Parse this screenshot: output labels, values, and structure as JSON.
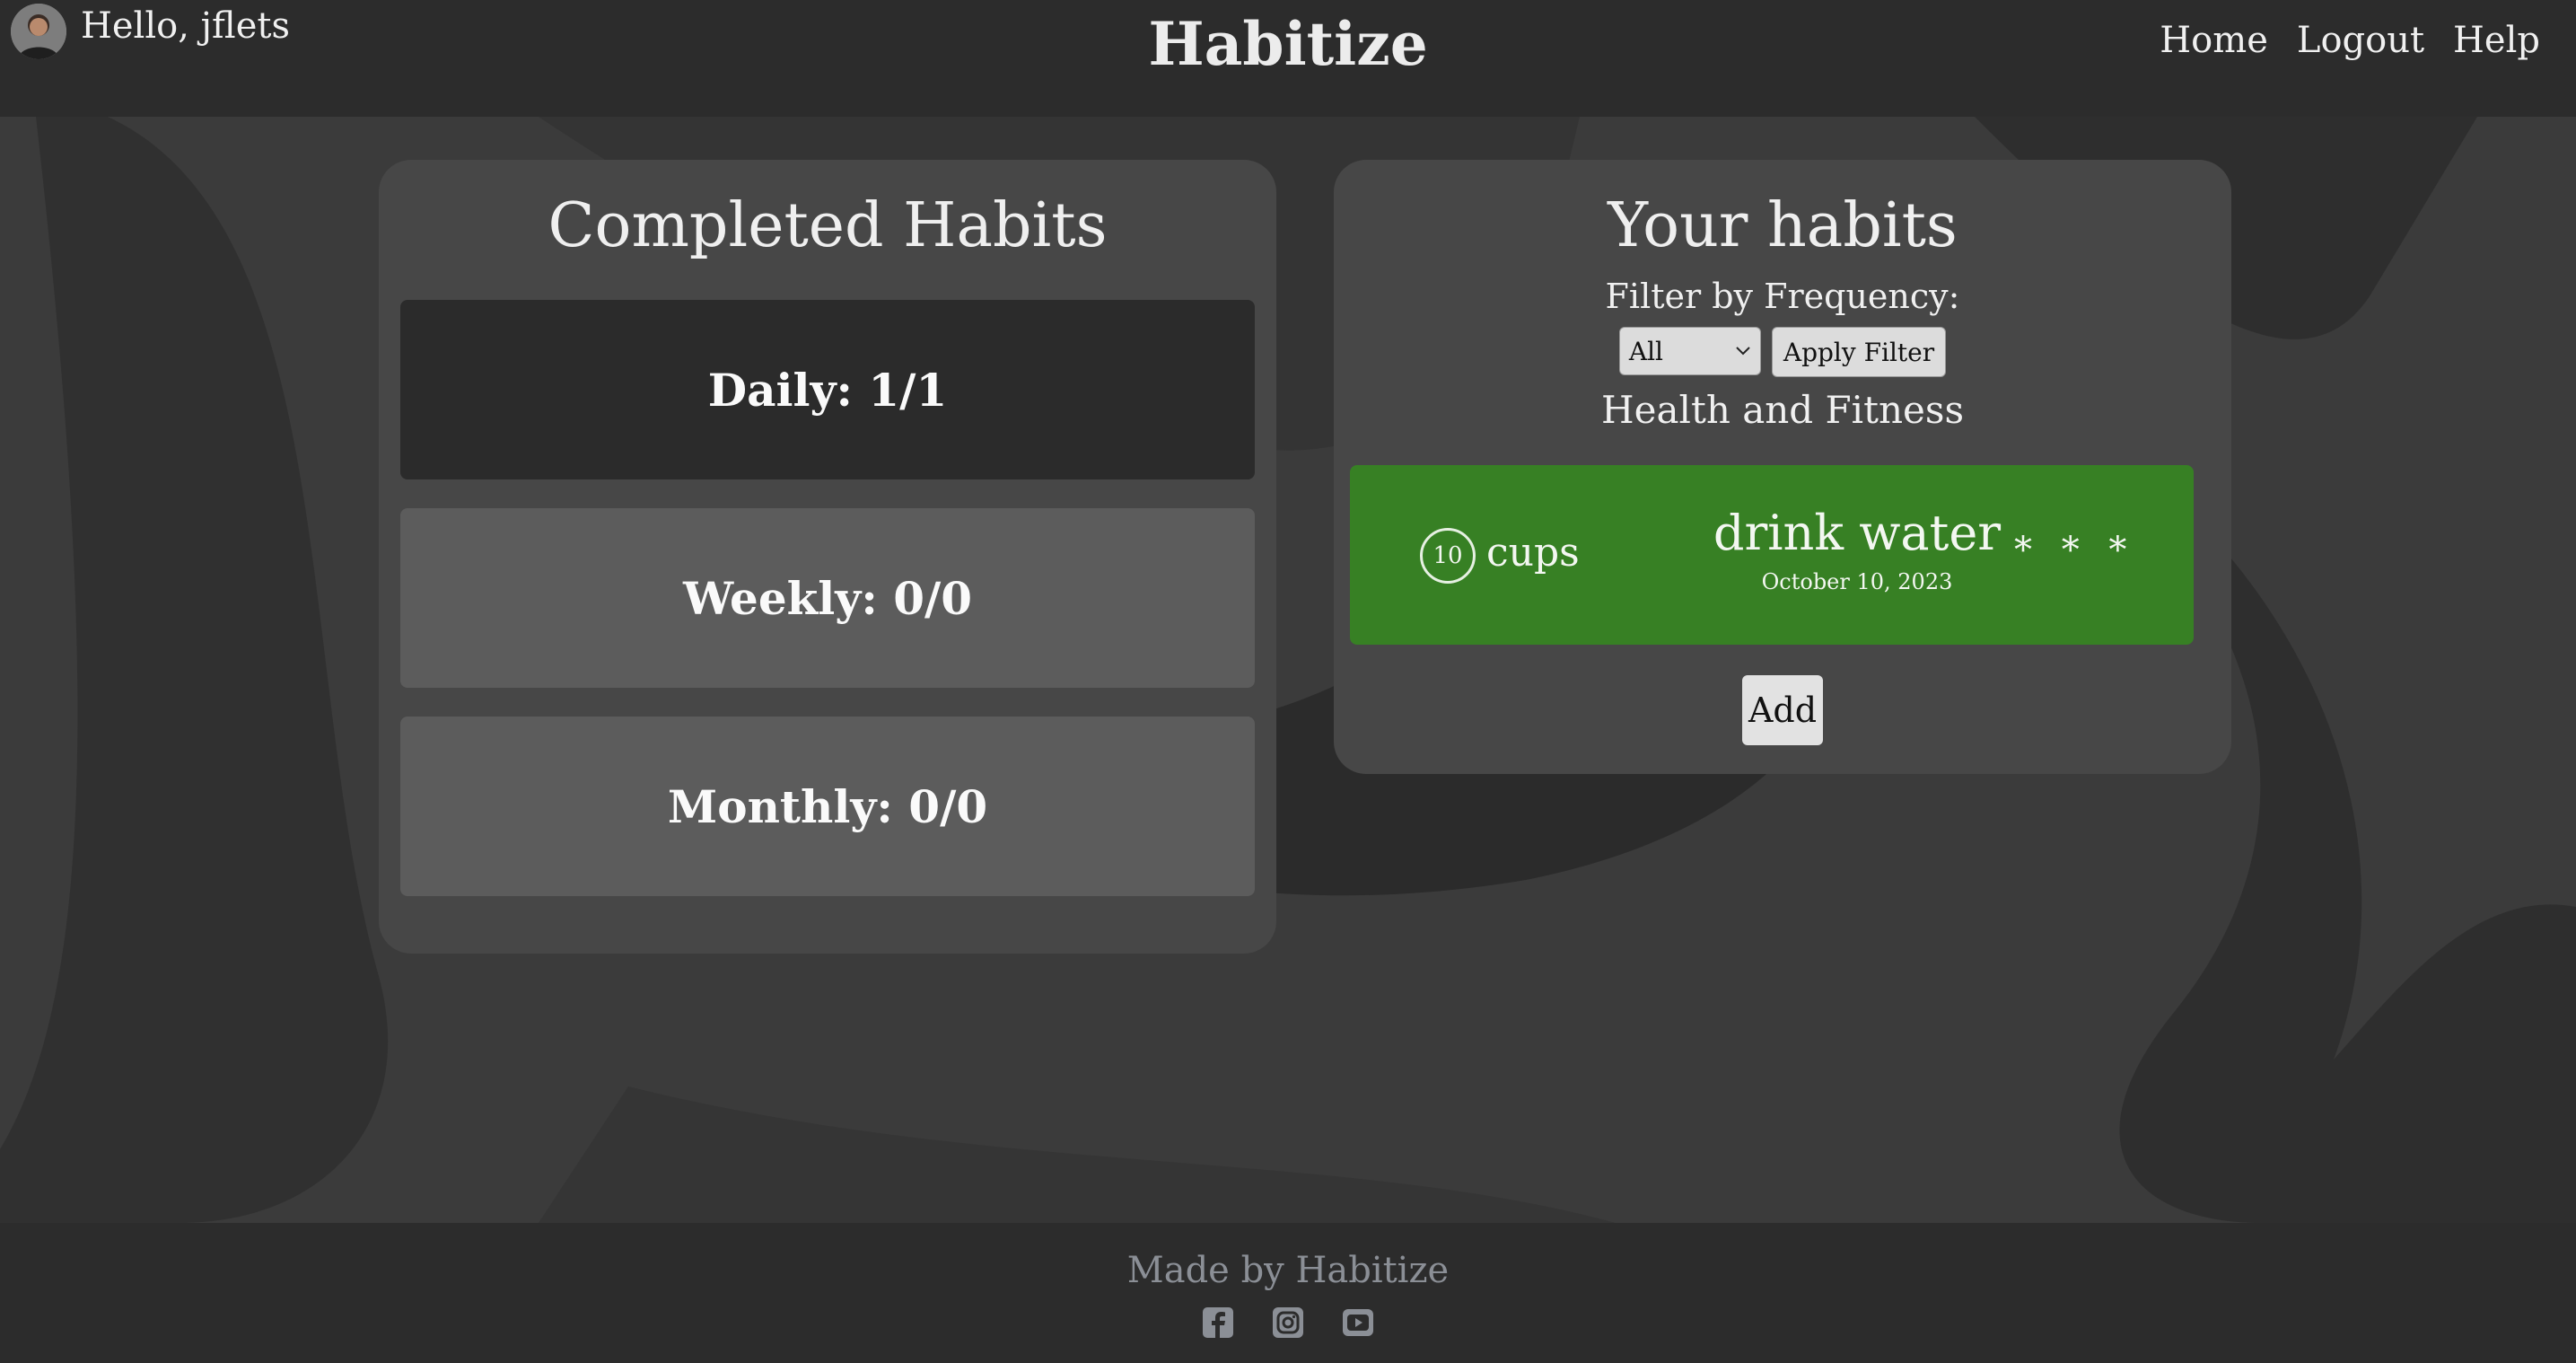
{
  "header": {
    "greeting": "Hello, jflets",
    "brand": "Habitize",
    "nav": [
      "Home",
      "Logout",
      "Help"
    ]
  },
  "completed": {
    "title": "Completed Habits",
    "daily": "Daily: 1/1",
    "weekly": "Weekly: 0/0",
    "monthly": "Monthly: 0/0"
  },
  "habits_panel": {
    "title": "Your habits",
    "filter_label": "Filter by Frequency:",
    "filter_selected": "All",
    "apply_label": "Apply Filter",
    "category": "Health and Fitness",
    "habit": {
      "count": "10",
      "unit": "cups",
      "name": "drink water",
      "date": "October 10, 2023",
      "menu": "* * *",
      "color": "#378024"
    },
    "add_label": "Add"
  },
  "footer": {
    "text": "Made by Habitize",
    "icons": [
      "facebook-icon",
      "instagram-icon",
      "youtube-icon"
    ]
  },
  "colors": {
    "navbar": "#2c2c2c",
    "card": "#474747",
    "habit": "#378024"
  }
}
